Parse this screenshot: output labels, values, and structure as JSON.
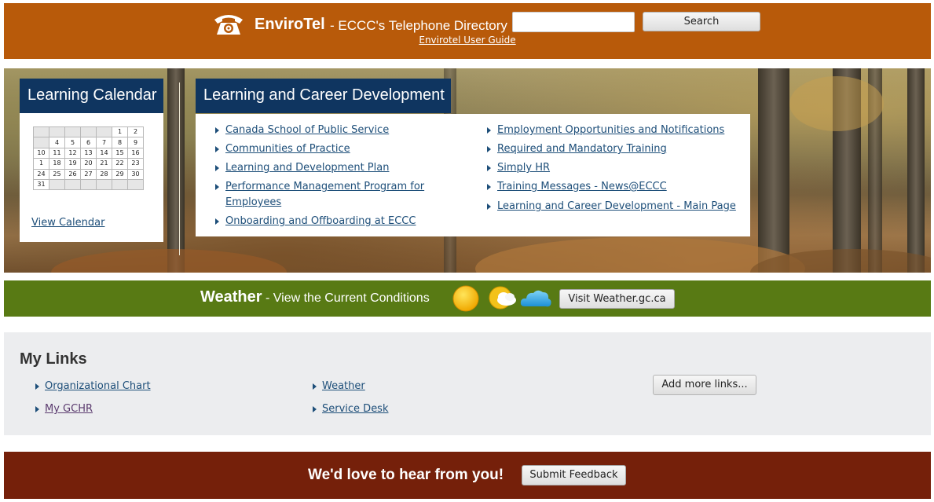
{
  "envirotel": {
    "brand": "EnviroTel",
    "subtitle": "- ECCC's Telephone Directory",
    "search_value": "",
    "search_button": "Search",
    "guide_link": "Envirotel User Guide"
  },
  "calendar": {
    "heading": "Learning Calendar",
    "weeks": [
      [
        "",
        "",
        "",
        "",
        "",
        "1",
        "2"
      ],
      [
        "",
        "4",
        "5",
        "6",
        "7",
        "8",
        "9"
      ],
      [
        "10",
        "11",
        "12",
        "13",
        "14",
        "15",
        "16"
      ],
      [
        "1",
        "18",
        "19",
        "20",
        "21",
        "22",
        "23"
      ],
      [
        "24",
        "25",
        "26",
        "27",
        "28",
        "29",
        "30"
      ],
      [
        "31",
        "",
        "",
        "",
        "",
        "",
        ""
      ]
    ],
    "view_link": "View Calendar"
  },
  "learning": {
    "heading": "Learning and Career Development",
    "left_links": [
      "Canada School of Public Service",
      "Communities of Practice",
      "Learning and Development Plan",
      "Performance Management Program for",
      "Employees",
      "Onboarding and Offboarding at ECCC"
    ],
    "right_links": [
      "Employment Opportunities and Notifications",
      "Required and Mandatory Training",
      "Simply HR",
      "Training Messages - News@ECCC",
      "Learning and Career Development - Main Page"
    ]
  },
  "weather": {
    "title": "Weather",
    "subtitle": "- View the Current Conditions",
    "icons": [
      "sun-icon",
      "sun-cloud-icon",
      "cloud-icon"
    ],
    "button": "Visit Weather.gc.ca"
  },
  "my_links": {
    "title": "My Links",
    "col1": [
      "Organizational Chart",
      "My GCHR"
    ],
    "col2": [
      "Weather",
      "Service Desk"
    ],
    "add_button": "Add more links..."
  },
  "feedback": {
    "text": "We'd love to hear from you!",
    "button": "Submit Feedback"
  },
  "colors": {
    "envirotel_bg": "#b85a0a",
    "header_navy": "#0f3560",
    "weather_bg": "#587a14",
    "mylinks_bg": "#ecedef",
    "feedback_bg": "#75200a",
    "link": "#1d4e79"
  }
}
